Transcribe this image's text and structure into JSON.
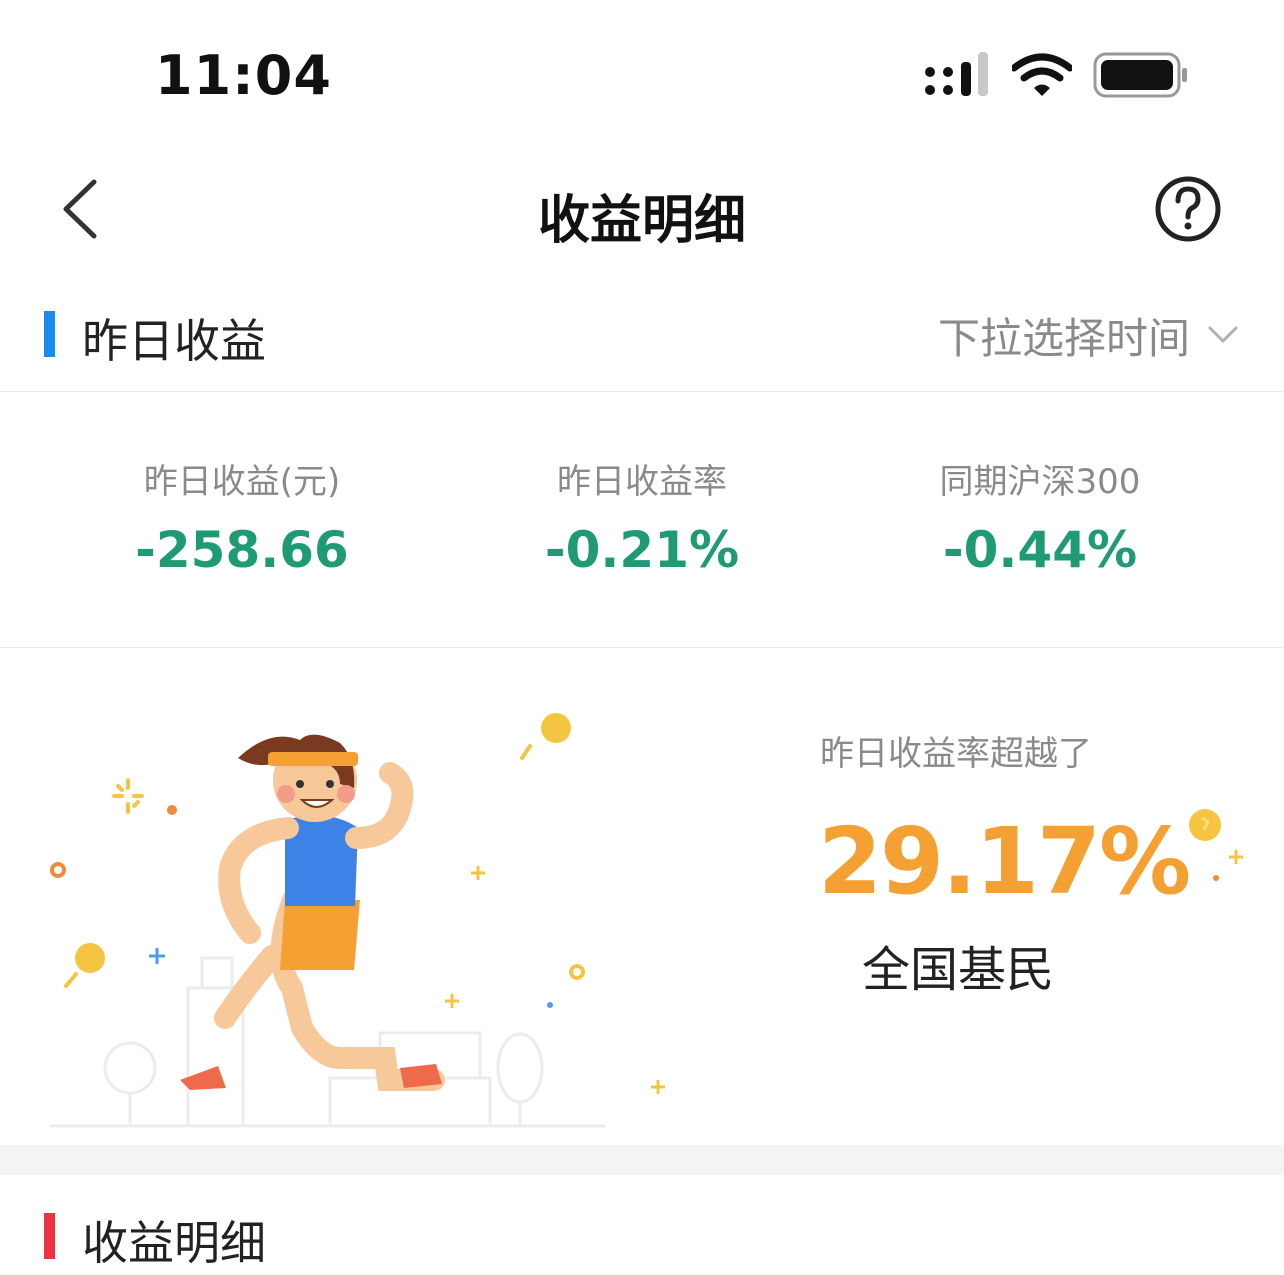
{
  "status_bar": {
    "time": "11:04"
  },
  "nav": {
    "title": "收益明细"
  },
  "yesterday_section": {
    "title": "昨日收益",
    "time_picker_label": "下拉选择时间"
  },
  "stats": [
    {
      "label": "昨日收益(元)",
      "value": "-258.66"
    },
    {
      "label": "昨日收益率",
      "value": "-0.21%"
    },
    {
      "label": "同期沪深300",
      "value": "-0.44%"
    }
  ],
  "comparison": {
    "label": "昨日收益率超越了",
    "value": "29.17%",
    "target": "全国基民"
  },
  "detail_section": {
    "title": "收益明细"
  },
  "colors": {
    "accent_blue": "#1a8cf0",
    "accent_red": "#ee3340",
    "negative_green": "#1e9b74",
    "highlight_orange": "#f5a033"
  }
}
